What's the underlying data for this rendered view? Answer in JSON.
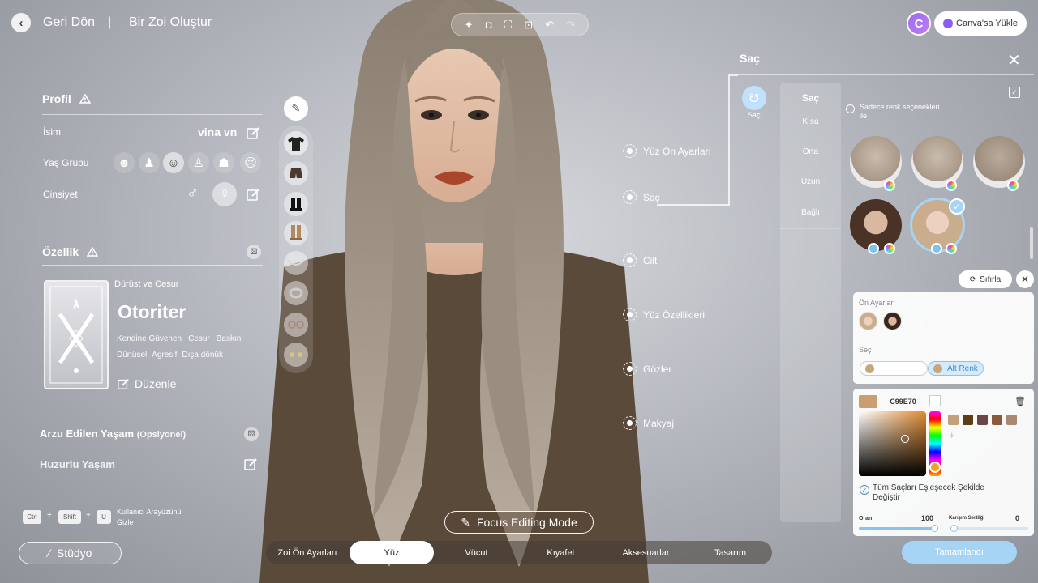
{
  "header": {
    "back_label": "Geri Dön",
    "separator": "|",
    "title": "Bir Zoi Oluştur",
    "canva_logo": "C",
    "canva_upload": "Canva'sa Yükle",
    "toolbar_icons": [
      "sparkle-icon",
      "camera-icon",
      "frame-icon",
      "face-scan-icon",
      "undo-icon",
      "redo-icon"
    ]
  },
  "profile": {
    "title": "Profil",
    "name_label": "İsim",
    "name_value": "vina vn",
    "age_label": "Yaş Grubu",
    "age_groups": [
      "baby-icon",
      "graduate-icon",
      "adult-icon",
      "person-icon",
      "hat-icon",
      "elder-icon"
    ],
    "age_selected_index": 2,
    "gender_label": "Cinsiyet",
    "gender_options": [
      "♂",
      "♀"
    ],
    "gender_selected_index": 1
  },
  "trait": {
    "title": "Özellik",
    "subtitle": "Dürüst ve Cesur",
    "name": "Otoriter",
    "tags_row1": [
      "Kendine Güvenen",
      "Cesur",
      "Baskın"
    ],
    "tags_row2": [
      "Dürtüsel",
      "Agresif",
      "Dışa dönük"
    ],
    "edit_label": "Düzenle"
  },
  "aspiration": {
    "title": "Arzu Edilen Yaşam",
    "optional": "(Opsiyonel)",
    "value": "Huzurlu Yaşam"
  },
  "shortcut": {
    "keys": [
      "Ctrl",
      "Shift",
      "U"
    ],
    "plus": "+",
    "label_line1": "Kullanıcı Arayüzünü",
    "label_line2": "Gizle"
  },
  "studio_label": "Stüdyo",
  "clothing_items": [
    "profile-edit-icon",
    "tshirt-icon",
    "shorts-icon",
    "boots-icon",
    "tall-boots-icon",
    "necklace-icon",
    "bracelet-icon",
    "glasses-icon",
    "earrings-icon"
  ],
  "face_menu": [
    "Yüz Ön Ayarları",
    "Saç",
    "Cilt",
    "Yüz Özellikleri",
    "Gözler",
    "Makyaj"
  ],
  "hair_panel": {
    "title": "Saç",
    "active_icon_label": "Saç",
    "categories_title": "Saç",
    "categories": [
      "Kısa",
      "Orta",
      "Uzun",
      "Bağlı"
    ],
    "color_only_label_1": "Sadece renk seçenekleri",
    "color_only_label_2": "ile",
    "reset_label": "Sıfırla"
  },
  "color_card": {
    "presets_label": "Ön Ayarlar",
    "select_label": "Seç",
    "base_color_label": "Temel Renk",
    "base_color": "#c9a57c",
    "sub_color_label": "Alt Renk",
    "sub_color": "#c9a57c",
    "hex_value": "C99E70",
    "current_color": "#c99e70",
    "swatches": [
      "#c4a07a",
      "#5a3f16",
      "#6b4548",
      "#8b5a3c",
      "#a88a70"
    ],
    "match_all_label_1": "Tüm Saçları Eşleşecek Şekilde",
    "match_all_label_2": "Değiştir",
    "ratio_label": "Oran",
    "ratio_value": "100",
    "ratio_fraction": 1.0,
    "blend_label": "Karışım Sertliği",
    "blend_value": "0",
    "blend_fraction": 0.0
  },
  "done_label": "Tamamlandı",
  "focus_mode_label": "Focus Editing Mode",
  "bottom_tabs": [
    "Zoi Ön Ayarları",
    "Yüz",
    "Vücut",
    "Kıyafet",
    "Aksesuarlar",
    "Tasarım"
  ],
  "bottom_tab_active_index": 1
}
